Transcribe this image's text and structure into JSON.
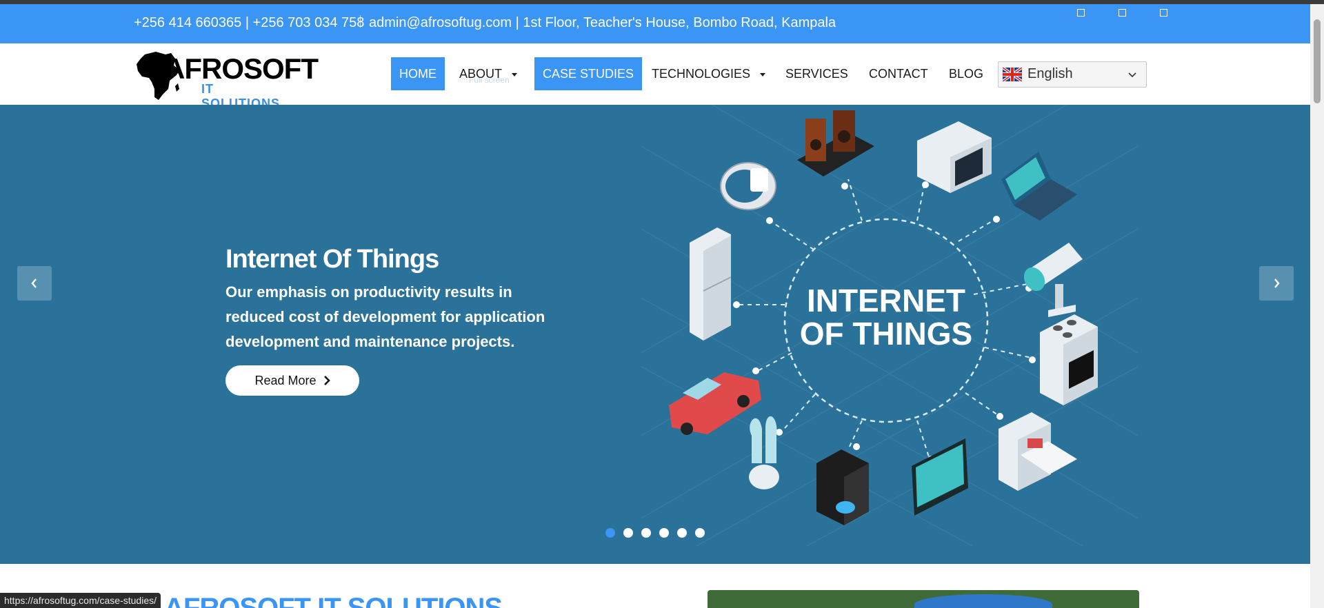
{
  "topbar": {
    "phones": "+256 414 660365 | +256 703 034 758",
    "contact": "admin@afrosoftug.com | 1st Floor, Teacher's House, Bombo Road, Kampala"
  },
  "logo": {
    "word1": "AFROSOFT",
    "word2": "IT SOLUTIONS"
  },
  "nav": {
    "home": "HOME",
    "about": "ABOUT",
    "case_studies": "CASE STUDIES",
    "technologies": "TECHNOLOGIES",
    "services": "SERVICES",
    "contact": "CONTACT",
    "blog": "BLOG",
    "ghost_text": "Full screen",
    "language": "English",
    "active_color": "#3a95f5"
  },
  "hero": {
    "title": "Internet Of Things",
    "text": "Our emphasis on productivity results in reduced cost of development for application development and maintenance projects.",
    "button": "Read More",
    "image_heading_1": "INTERNET",
    "image_heading_2": "OF THINGS",
    "slide_count": 6,
    "active_slide": 1,
    "background": "#2a7299"
  },
  "below": {
    "title": "AFROSOFT IT SOLUTIONS"
  },
  "status_bar": {
    "url": "https://afrosoftug.com/case-studies/"
  }
}
